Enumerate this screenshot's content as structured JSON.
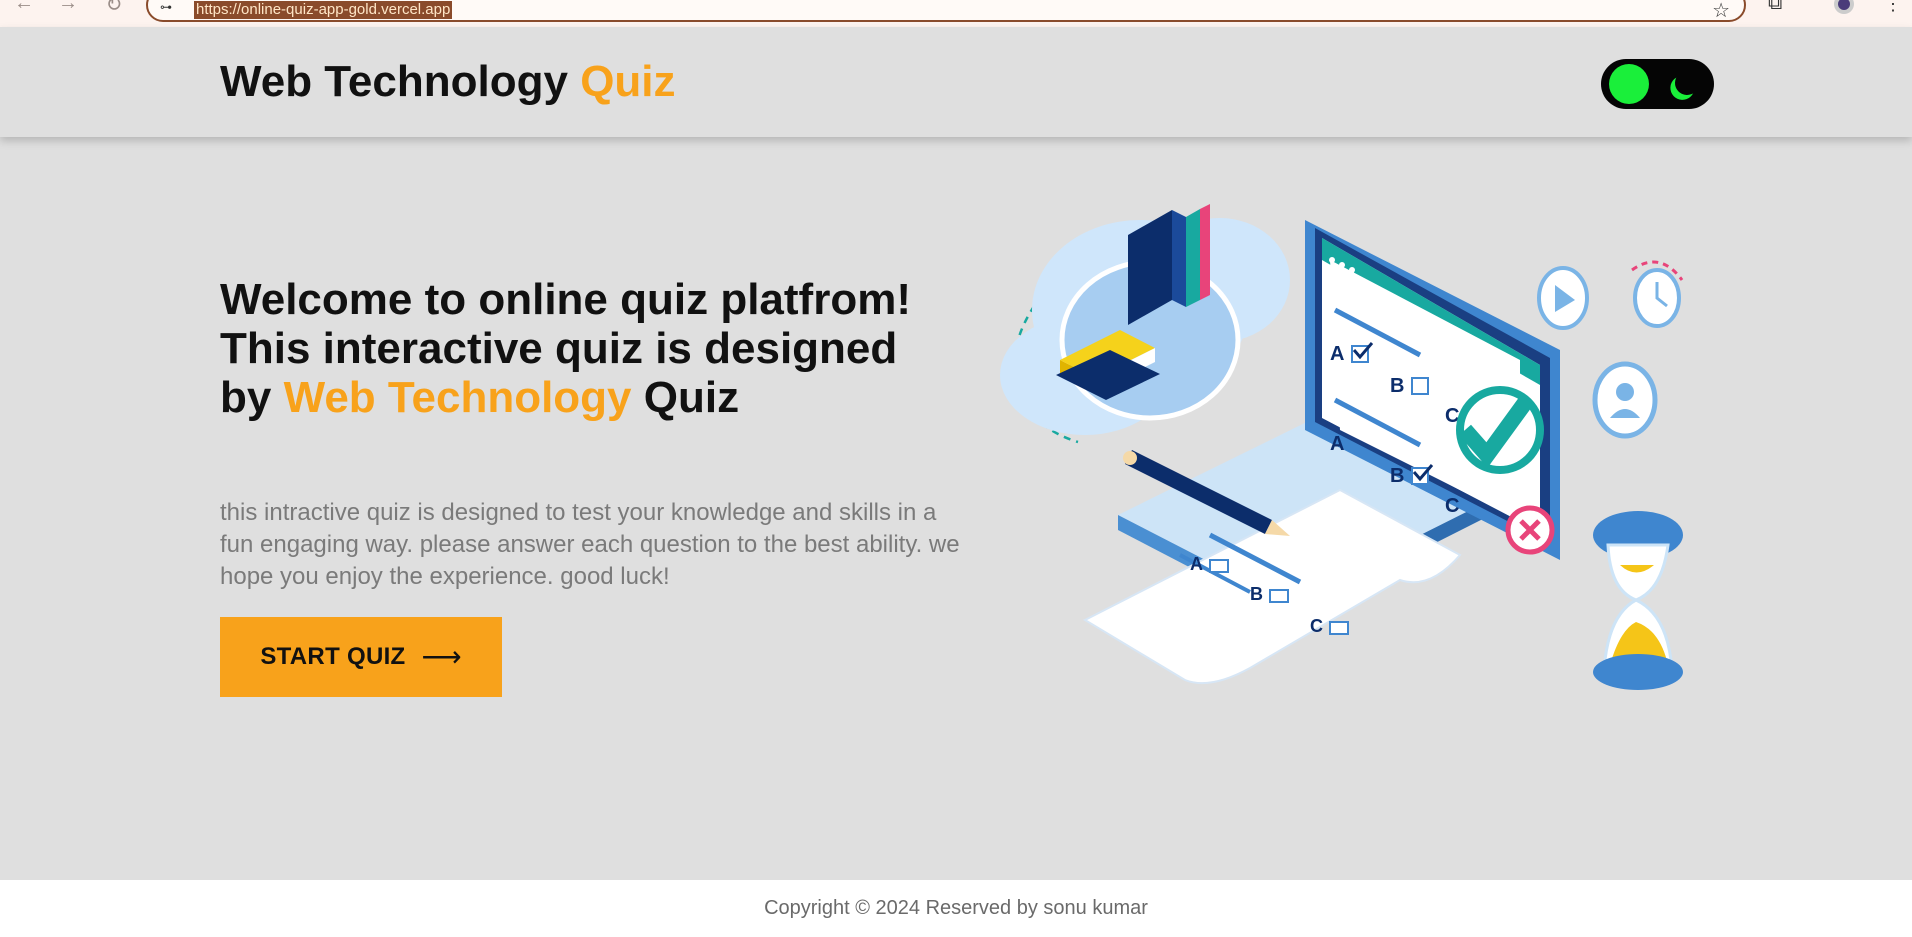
{
  "browser": {
    "url": "https://online-quiz-app-gold.vercel.app"
  },
  "header": {
    "logo_main": "Web Technology",
    "logo_accent": "Quiz"
  },
  "hero": {
    "title_part1": "Welcome to online quiz platfrom! This interactive quiz is designed by ",
    "title_accent": "Web Technology",
    "title_part2": " Quiz",
    "description": "this intractive quiz is designed to test your knowledge and skills in a fun engaging way. please answer each question to the best ability. we hope you enjoy the experience. good luck!",
    "button_label": "START QUIZ"
  },
  "illustration": {
    "answer_letters": [
      "A",
      "B",
      "C"
    ]
  },
  "footer": {
    "copyright": "Copyright © 2024 Reserved by sonu kumar"
  },
  "colors": {
    "accent": "#f8a21b",
    "background": "#dfdfdf",
    "toggle_green": "#1aef3a"
  }
}
